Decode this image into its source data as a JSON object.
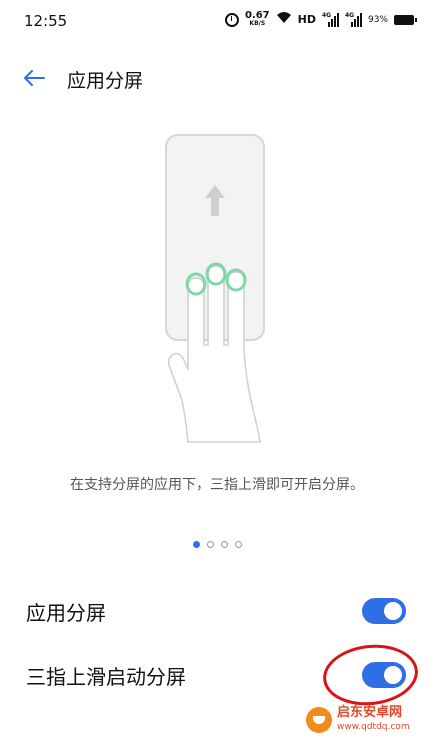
{
  "status_bar": {
    "time": "12:55",
    "net_speed_value": "0.67",
    "net_speed_unit": "KB/S",
    "hd_label": "HD",
    "signal1_label": "4G",
    "signal2_label": "4G",
    "battery_text": "93%",
    "icons": [
      "alarm-icon",
      "wifi-icon",
      "signal-icon",
      "battery-icon"
    ]
  },
  "header": {
    "back_icon": "back-arrow-icon",
    "title": "应用分屏"
  },
  "illustration": {
    "icons": [
      "phone-outline-icon",
      "up-arrow-icon",
      "three-finger-hand-icon"
    ]
  },
  "description": "在支持分屏的应用下，三指上滑即可开启分屏。",
  "pager": {
    "total": 4,
    "active_index": 0
  },
  "settings": [
    {
      "label": "应用分屏",
      "enabled": true
    },
    {
      "label": "三指上滑启动分屏",
      "enabled": true
    }
  ],
  "colors": {
    "accent": "#2f6ee6",
    "annotation": "#d8141a",
    "finger_highlight": "#7fd8a8"
  },
  "watermark": {
    "name": "启东安卓网",
    "url": "www.qdtdq.com"
  }
}
